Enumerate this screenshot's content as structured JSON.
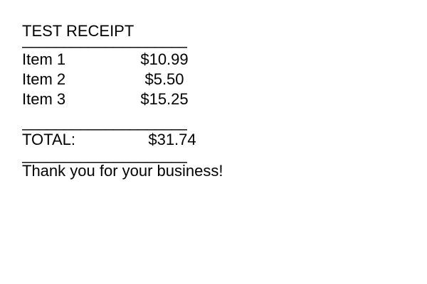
{
  "receipt": {
    "title": "TEST RECEIPT",
    "divider": "______________________________",
    "items": [
      {
        "name": "Item 1",
        "price": "$10.99"
      },
      {
        "name": "Item 2",
        "price": "$5.50"
      },
      {
        "name": "Item 3",
        "price": "$15.25"
      }
    ],
    "total_label": "TOTAL:",
    "total_value": "$31.74",
    "footer": "Thank you for your business!"
  }
}
